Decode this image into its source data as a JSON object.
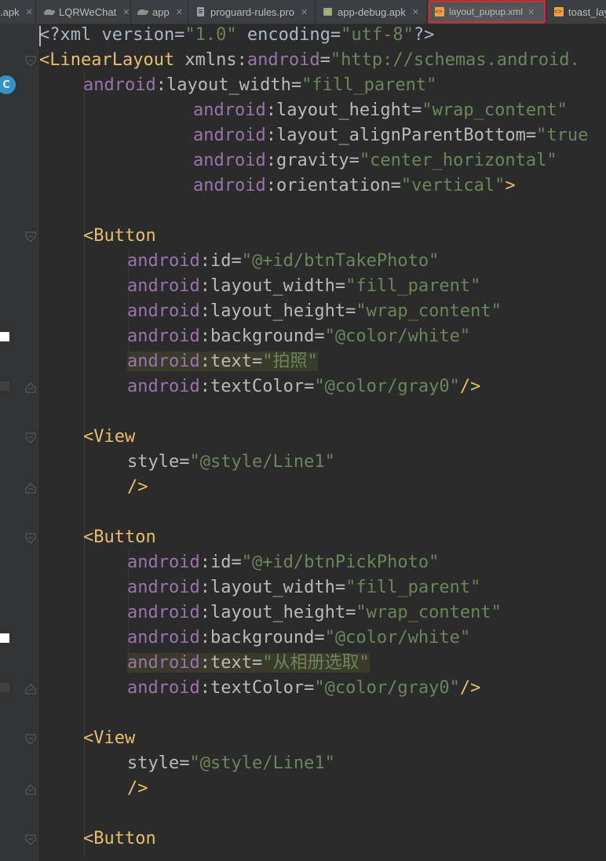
{
  "tabs": [
    {
      "label": ".apk",
      "icon": "apk-icon",
      "active": false
    },
    {
      "label": "LQRWeChat",
      "icon": "module-icon",
      "active": false
    },
    {
      "label": "app",
      "icon": "module-icon",
      "active": false
    },
    {
      "label": "proguard-rules.pro",
      "icon": "file-icon",
      "active": false
    },
    {
      "label": "app-debug.apk",
      "icon": "apk-icon",
      "active": false
    },
    {
      "label": "layout_pupup.xml",
      "icon": "xml-icon",
      "active": true
    },
    {
      "label": "toast_lay",
      "icon": "xml-icon",
      "active": false
    }
  ],
  "gutter": {
    "class_badge": "C",
    "swatch_color": "#ffffff",
    "swatch_alt_color": "#404040"
  },
  "colors": {
    "background": "#2b2b2b",
    "tag": "#e8bf6a",
    "namespace": "#9876aa",
    "string": "#6a8759",
    "highlight_box": "#e0262b"
  },
  "code": {
    "l1": {
      "a": "<?xml version=",
      "b": "\"1.0\"",
      "c": " encoding=",
      "d": "\"utf-8\"",
      "e": "?>"
    },
    "l2": {
      "tag": "<LinearLayout",
      "attr": " xmlns:",
      "ns": "android",
      "eq": "=",
      "val": "\"http://schemas.android."
    },
    "l3": {
      "ns": "android",
      "attr": ":layout_width=",
      "val": "\"fill_parent\""
    },
    "l4": {
      "ns": "android",
      "attr": ":layout_height=",
      "val": "\"wrap_content\""
    },
    "l5": {
      "ns": "android",
      "attr": ":layout_alignParentBottom=",
      "val": "\"true"
    },
    "l6": {
      "ns": "android",
      "attr": ":gravity=",
      "val": "\"center_horizontal\""
    },
    "l7": {
      "ns": "android",
      "attr": ":orientation=",
      "val": "\"vertical\"",
      "end": ">"
    },
    "b1": {
      "tag": "<Button",
      "id_ns": "android",
      "id_attr": ":id=",
      "id_val": "\"@+id/btnTakePhoto\"",
      "w_ns": "android",
      "w_attr": ":layout_width=",
      "w_val": "\"fill_parent\"",
      "h_ns": "android",
      "h_attr": ":layout_height=",
      "h_val": "\"wrap_content\"",
      "bg_ns": "android",
      "bg_attr": ":background=",
      "bg_val": "\"@color/white\"",
      "t_ns": "android",
      "t_attr": ":text=",
      "t_val": "\"拍照\"",
      "c_ns": "android",
      "c_attr": ":textColor=",
      "c_val": "\"@color/gray0\"",
      "c_end": "/>"
    },
    "v1": {
      "tag": "<View",
      "s_attr": "style=",
      "s_val": "\"@style/Line1\"",
      "end": "/>"
    },
    "b2": {
      "tag": "<Button",
      "id_ns": "android",
      "id_attr": ":id=",
      "id_val": "\"@+id/btnPickPhoto\"",
      "w_ns": "android",
      "w_attr": ":layout_width=",
      "w_val": "\"fill_parent\"",
      "h_ns": "android",
      "h_attr": ":layout_height=",
      "h_val": "\"wrap_content\"",
      "bg_ns": "android",
      "bg_attr": ":background=",
      "bg_val": "\"@color/white\"",
      "t_ns": "android",
      "t_attr": ":text=",
      "t_val": "\"从相册选取\"",
      "c_ns": "android",
      "c_attr": ":textColor=",
      "c_val": "\"@color/gray0\"",
      "c_end": "/>"
    },
    "v2": {
      "tag": "<View",
      "s_attr": "style=",
      "s_val": "\"@style/Line1\"",
      "end": "/>"
    },
    "b3": {
      "tag": "<Button"
    }
  }
}
